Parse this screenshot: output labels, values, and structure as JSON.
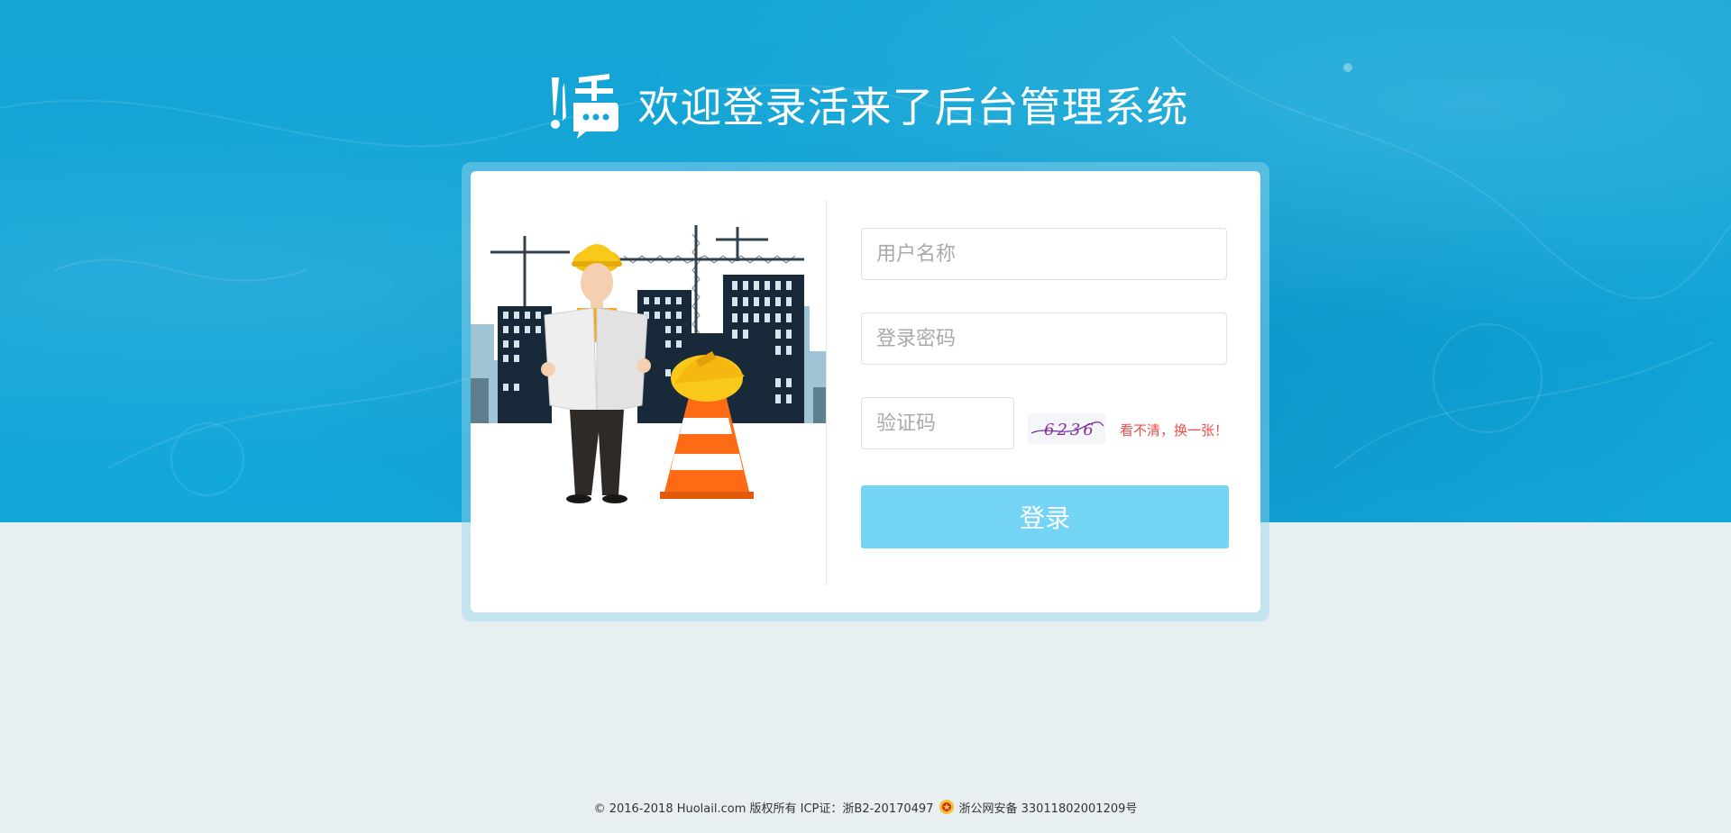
{
  "header": {
    "logo_icon": "huolai-speech-logo-icon",
    "title": "欢迎登录活来了后台管理系统"
  },
  "login": {
    "username_placeholder": "用户名称",
    "password_placeholder": "登录密码",
    "captcha_placeholder": "验证码",
    "captcha_code": "6236",
    "captcha_refresh": "看不清，换一张！",
    "submit_label": "登录"
  },
  "illustration": {
    "name": "construction-worker-illustration"
  },
  "footer": {
    "copyright": "© 2016-2018 Huolail.com 版权所有 ICP证：浙B2-20170497",
    "police_icon": "public-security-badge-icon",
    "police_record": "浙公网安备 33011802001209号"
  },
  "colors": {
    "brand_blue": "#0fa3d6",
    "button_bg": "#74d4f5",
    "link_red": "#f24b4b",
    "page_bg": "#e8eff1"
  }
}
